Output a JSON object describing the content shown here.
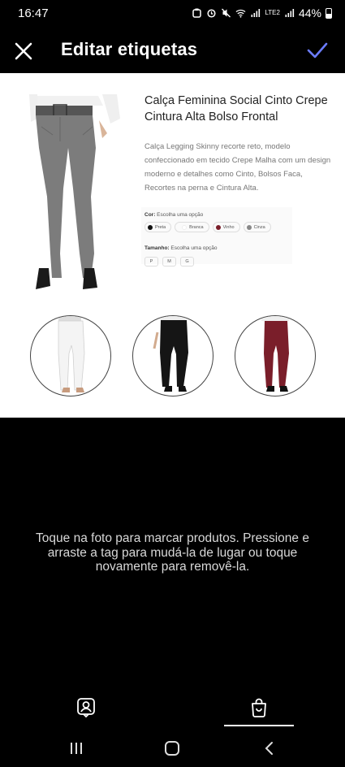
{
  "status_bar": {
    "time": "16:47",
    "battery": "44%",
    "network": "LTE2"
  },
  "header": {
    "title": "Editar etiquetas",
    "close_icon": "close-icon",
    "confirm_icon": "check-icon",
    "accent_color": "#6b7cff"
  },
  "product": {
    "title": "Calça Feminina Social Cinto Crepe Cintura Alta Bolso Frontal",
    "description": "Calça Legging Skinny recorte reto, modelo confeccionado em tecido Crepe Malha com um design moderno e detalhes como Cinto, Bolsos Faca, Recortes na perna e Cintura Alta.",
    "color_label": "Cor:",
    "color_hint": "Escolha uma opção",
    "colors": [
      {
        "name": "Preta",
        "hex": "#111111"
      },
      {
        "name": "Branca",
        "hex": "#ffffff"
      },
      {
        "name": "Vinho",
        "hex": "#7a1e2a"
      },
      {
        "name": "Cinza",
        "hex": "#888888"
      }
    ],
    "size_label": "Tamanho:",
    "size_hint": "Escolha uma opção",
    "sizes": [
      "P",
      "M",
      "G"
    ]
  },
  "hint": "Toque na foto para marcar produtos. Pressione e arraste a tag para mudá-la de lugar ou toque novamente para removê-la.",
  "tabs": [
    {
      "name": "people-tag-tab",
      "icon": "person-tag-icon"
    },
    {
      "name": "product-tag-tab",
      "icon": "shopping-bag-icon",
      "active": true
    }
  ],
  "navbar": {
    "recents_icon": "recents-icon",
    "home_icon": "home-icon",
    "back_icon": "back-icon"
  }
}
